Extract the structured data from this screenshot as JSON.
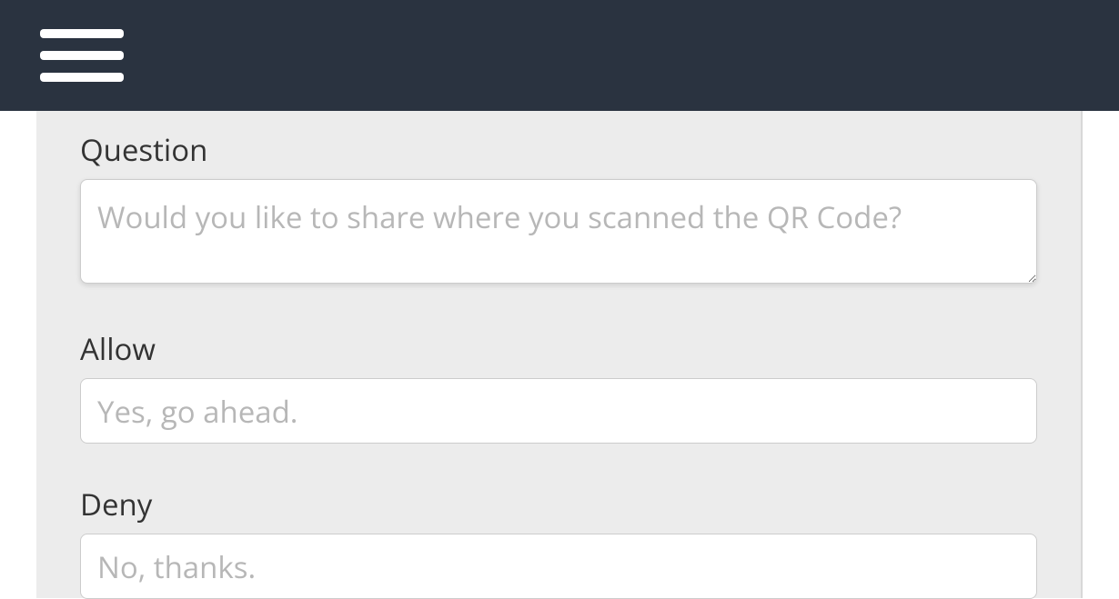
{
  "header": {
    "menu_icon": "hamburger-menu"
  },
  "form": {
    "question": {
      "label": "Question",
      "placeholder": "Would you like to share where you scanned the QR Code?",
      "value": ""
    },
    "allow": {
      "label": "Allow",
      "placeholder": "Yes, go ahead.",
      "value": ""
    },
    "deny": {
      "label": "Deny",
      "placeholder": "No, thanks.",
      "value": ""
    }
  }
}
